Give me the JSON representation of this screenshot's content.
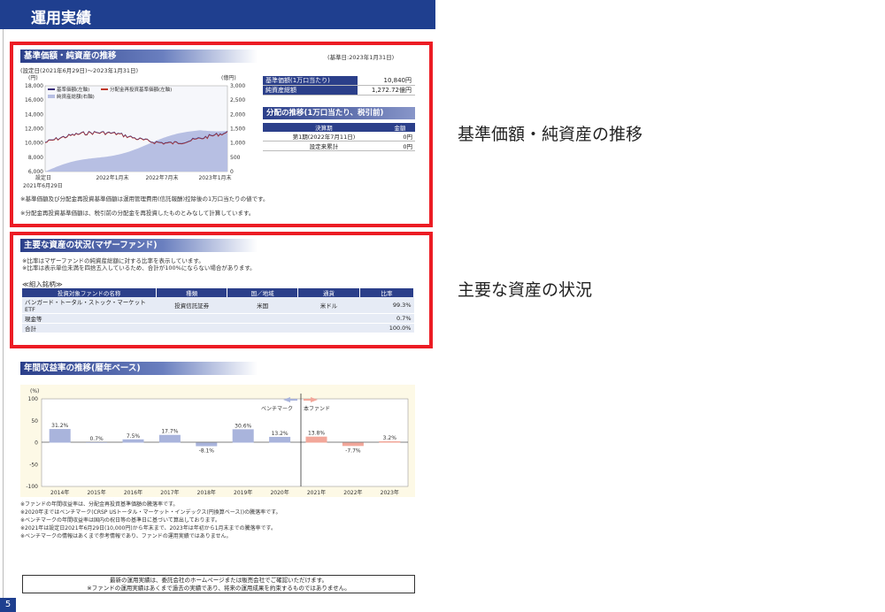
{
  "page": {
    "title": "運用実績",
    "page_number": "5"
  },
  "nav_section": {
    "title": "基準価額・純資産の推移",
    "base_date": "(基準日:2023年1月31日)",
    "period": "(設定日(2021年6月29日)～2023年1月31日)",
    "left_unit": "(円)",
    "right_unit": "(億円)",
    "legend_nav": "基準価額(左軸)",
    "legend_div_nav": "分配金再投資基準価額(左軸)",
    "legend_assets": "純資産総額(右軸)",
    "note1": "※基準価額及び分配金再投資基準価額は運用管理費用(信託報酬)控除後の1万口当たりの値です。",
    "note2": "※分配金再投資基準価額は、税引前の分配金を再投資したものとみなして計算しています。",
    "setup_label": "設定日",
    "setup_date": "2021年6月29日"
  },
  "nav_chart": {
    "chart_data": {
      "type": "line",
      "left_axis": {
        "min": 6000,
        "max": 18000,
        "ticks": [
          "18,000",
          "16,000",
          "14,000",
          "12,000",
          "10,000",
          "8,000",
          "6,000"
        ]
      },
      "right_axis": {
        "min": 0,
        "max": 3000,
        "ticks": [
          "3,000",
          "2,500",
          "2,000",
          "1,500",
          "1,000",
          "500",
          "0"
        ]
      },
      "x_ticks": [
        "2022年1月末",
        "2022年7月末",
        "2023年1月末"
      ]
    }
  },
  "summary": {
    "nav_label": "基準価額(1万口当たり)",
    "nav_value": "10,840円",
    "assets_label": "純資産総額",
    "assets_value": "1,272.72億円"
  },
  "distribution": {
    "title": "分配の推移(1万口当たり、税引前)",
    "header_period": "決算期",
    "header_amount": "金額",
    "rows": [
      {
        "period": "第1期(2022年7月11日)",
        "amount": "0円"
      },
      {
        "period": "設定来累計",
        "amount": "0円"
      }
    ]
  },
  "side_labels": {
    "nav": "基準価額・純資産の推移",
    "assets": "主要な資産の状況"
  },
  "holdings": {
    "title": "主要な資産の状況(マザーファンド)",
    "note1": "※比率はマザーファンドの純資産総額に対する比率を表示しています。",
    "note2": "※比率は表示単位未満を四捨五入しているため、合計が100%にならない場合があります。",
    "subtitle": "≪組入銘柄≫",
    "headers": [
      "投資対象ファンドの名称",
      "種類",
      "国／地域",
      "通貨",
      "比率"
    ],
    "rows": [
      [
        "バンガード・トータル・ストック・マーケットETF",
        "投資信託証券",
        "米国",
        "米ドル",
        "99.3%"
      ],
      [
        "現金等",
        "",
        "",
        "",
        "0.7%"
      ],
      [
        "合計",
        "",
        "",
        "",
        "100.0%"
      ]
    ]
  },
  "annual": {
    "title": "年間収益率の推移(暦年ベース)",
    "unit": "(%)",
    "benchmark_label": "ベンチマーク",
    "fund_label": "本ファンド",
    "notes": [
      "※ファンドの年間収益率は、分配金再投資基準価額の騰落率です。",
      "※2020年まではベンチマーク(CRSP USトータル・マーケット・インデックス(円換算ベース))の騰落率です。",
      "※ベンチマークの年間収益率は国内の祝日等の基準日に基づいて算出しております。",
      "※2021年は設定日2021年6月29日(10,000円)から年末まで、2023年は年初から1月末までの騰落率です。",
      "※ベンチマークの情報はあくまで参考情報であり、ファンドの運用実績ではありません。"
    ],
    "chart_data": {
      "type": "bar",
      "categories": [
        "2014年",
        "2015年",
        "2016年",
        "2017年",
        "2018年",
        "2019年",
        "2020年",
        "2021年",
        "2022年",
        "2023年"
      ],
      "values": [
        31.2,
        0.7,
        7.5,
        17.7,
        -8.1,
        30.6,
        13.2,
        13.8,
        -7.7,
        3.2
      ],
      "labels": [
        "31.2%",
        "0.7%",
        "7.5%",
        "17.7%",
        "-8.1%",
        "30.6%",
        "13.2%",
        "13.8%",
        "-7.7%",
        "3.2%"
      ],
      "series_type": [
        "benchmark",
        "benchmark",
        "benchmark",
        "benchmark",
        "benchmark",
        "benchmark",
        "benchmark",
        "fund",
        "fund",
        "fund"
      ],
      "ylim": [
        -100,
        100
      ],
      "yticks": [
        "100",
        "50",
        "0",
        "-50",
        "-100"
      ]
    }
  },
  "footer": {
    "line1": "最新の運用実績は、委託会社のホームページまたは販売会社でご確認いただけます。",
    "line2": "※ファンドの運用実績はあくまで過去の実績であり、将来の運用成果を約束するものではありません。"
  },
  "colors": {
    "navy": "#1f3f8f",
    "red": "#ec1c24",
    "benchmark_bar": "#a9b4dc",
    "fund_bar": "#f2a79a",
    "nav_line": "#3a2f7a",
    "assets_area": "#b7bfe3"
  }
}
